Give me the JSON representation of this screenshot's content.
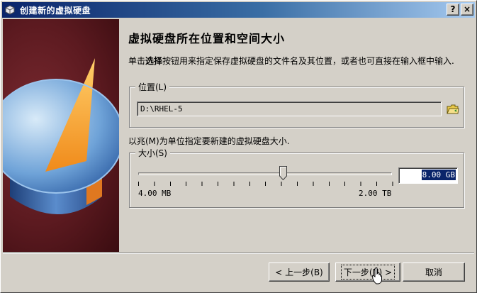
{
  "window": {
    "title": "创建新的虚拟硬盘",
    "help_button": "?",
    "close_button": "×"
  },
  "page": {
    "title": "虚拟硬盘所在位置和空间大小",
    "description_prefix": "单击",
    "description_bold": "选择",
    "description_suffix": "按钮用来指定保存虚拟硬盘的文件名及其位置，或者也可直接在输入框中输入."
  },
  "location": {
    "legend": "位置(L)",
    "value": "D:\\RHEL-5"
  },
  "size_description": "以兆(M)为单位指定要新建的虚拟硬盘大小.",
  "size": {
    "legend": "大小(S)",
    "min_label": "4.00 MB",
    "max_label": "2.00 TB",
    "value": "8.00 GB",
    "slider_fraction": 0.58
  },
  "buttons": {
    "back": "< 上一步(B)",
    "next": "下一步(N) >",
    "cancel": "取消"
  }
}
